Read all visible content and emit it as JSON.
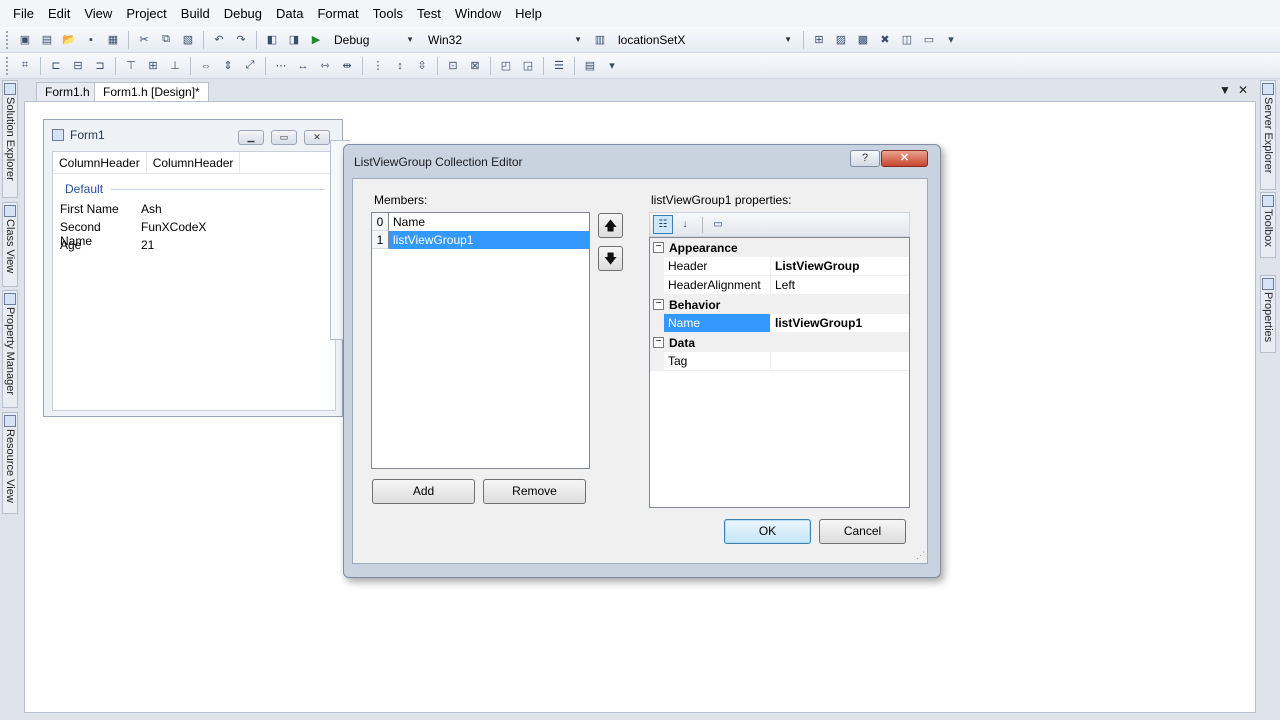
{
  "menu": [
    "File",
    "Edit",
    "View",
    "Project",
    "Build",
    "Debug",
    "Data",
    "Format",
    "Tools",
    "Test",
    "Window",
    "Help"
  ],
  "toolbar": {
    "configuration": "Debug",
    "platform": "Win32",
    "find_text": "locationSetX"
  },
  "doc_tabs": {
    "tab1": "Form1.h",
    "tab2": "Form1.h [Design]*"
  },
  "side_panels": {
    "left": [
      "Solution Explorer",
      "Class View",
      "Property Manager",
      "Resource View"
    ],
    "right": [
      "Server Explorer",
      "Toolbox",
      "Properties"
    ]
  },
  "form1": {
    "title": "Form1",
    "columns": [
      "ColumnHeader",
      "ColumnHeader"
    ],
    "group": "Default",
    "rows": [
      {
        "name": "First Name",
        "value": "Ash"
      },
      {
        "name": "Second Name",
        "value": "FunXCodeX"
      },
      {
        "name": "Age",
        "value": "21"
      }
    ]
  },
  "dialog": {
    "title": "ListViewGroup Collection Editor",
    "help_label": "?",
    "close_label": "✕",
    "members_label": "Members:",
    "members": [
      {
        "index": "0",
        "name": "Name"
      },
      {
        "index": "1",
        "name": "listViewGroup1"
      }
    ],
    "add_label": "Add",
    "remove_label": "Remove",
    "properties_label": "listViewGroup1 properties:",
    "categories": [
      {
        "name": "Appearance",
        "props": [
          {
            "name": "Header",
            "value": "ListViewGroup"
          },
          {
            "name": "HeaderAlignment",
            "value": "Left"
          }
        ]
      },
      {
        "name": "Behavior",
        "props": [
          {
            "name": "Name",
            "value": "listViewGroup1"
          }
        ]
      },
      {
        "name": "Data",
        "props": [
          {
            "name": "Tag",
            "value": ""
          }
        ]
      }
    ],
    "ok_label": "OK",
    "cancel_label": "Cancel"
  },
  "colors": {
    "selection": "#3399ff",
    "close_button": "#c8452e",
    "group_text": "#1e4e9c"
  }
}
